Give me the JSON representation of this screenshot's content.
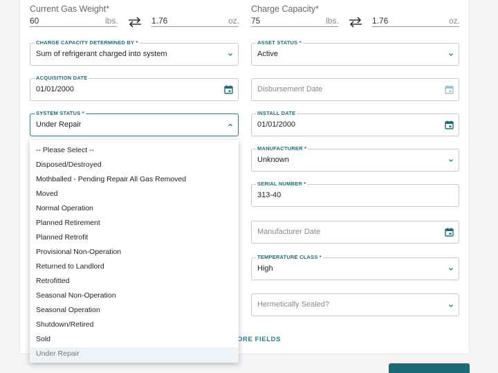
{
  "top": {
    "current_gas_weight": {
      "label": "Current Gas Weight*",
      "lbs_value": "60",
      "lbs_unit": "lbs.",
      "oz_value": "1.76",
      "oz_unit": "oz."
    },
    "charge_capacity": {
      "label": "Charge Capacity*",
      "lbs_value": "75",
      "lbs_unit": "lbs.",
      "oz_value": "1.76",
      "oz_unit": "oz."
    }
  },
  "fields": {
    "charge_capacity_determined_by": {
      "label": "CHARGE CAPACITY DETERMINED BY *",
      "value": "Sum of refrigerant charged into system"
    },
    "asset_status": {
      "label": "ASSET STATUS *",
      "value": "Active"
    },
    "acquisition_date": {
      "label": "ACQUISITION DATE",
      "value": "01/01/2000"
    },
    "disbursement_date": {
      "placeholder": "Disbursement Date"
    },
    "system_status": {
      "label": "SYSTEM STATUS *",
      "value": "Under Repair"
    },
    "install_date": {
      "label": "INSTALL DATE",
      "value": "01/01/2000"
    },
    "manufacturer": {
      "label": "MANUFACTURER *",
      "value": "Unknown"
    },
    "serial_number": {
      "label": "SERIAL NUMBER *",
      "value": "313-40"
    },
    "manufacturer_date": {
      "placeholder": "Manufacturer Date"
    },
    "temperature_class": {
      "label": "TEMPERATURE CLASS *",
      "value": "High"
    },
    "hermetically_sealed": {
      "placeholder": "Hermetically Sealed?"
    }
  },
  "more_fields_link": "ORE FIELDS",
  "system_status_options": [
    "-- Please Select --",
    "Disposed/Destroyed",
    "Mothballed - Pending Repair All Gas Removed",
    "Moved",
    "Normal Operation",
    "Planned Retirement",
    "Planned Retrofit",
    "Provisional Non-Operation",
    "Returned to Landlord",
    "Retrofitted",
    "Seasonal Non-Operation",
    "Seasonal Operation",
    "Shutdown/Retired",
    "Sold",
    "Under Repair"
  ],
  "selected_option_index": 14,
  "colors": {
    "accent": "#1f7d8c",
    "label": "#1f6c7a",
    "button": "#1b6a79"
  }
}
